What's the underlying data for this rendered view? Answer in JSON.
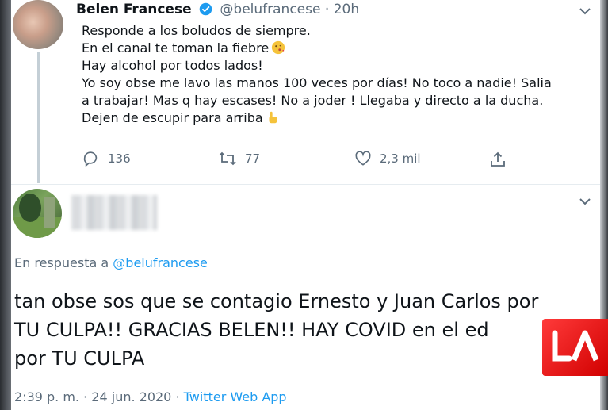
{
  "tweet1": {
    "name": "Belen Francese",
    "handle": "@belufrancese",
    "separator": "·",
    "time": "20h",
    "lines": [
      "Responde a los boludos de siempre.",
      "En el canal te toman la fiebre",
      "Hay alcohol por todos lados!",
      "Yo soy obse me lavo las manos 100 veces por días! No toco  a nadie! Salia",
      "a trabajar! Mas q hay escases! No a joder ! Llegaba y directo a la ducha.",
      "Dejen de escupir para arriba"
    ],
    "emoji_line2": "kiss-emoji",
    "emoji_line6": "pointing-up-emoji",
    "replies": "136",
    "retweets": "77",
    "likes": "2,3 mil"
  },
  "tweet2": {
    "reply_prefix": "En respuesta a",
    "reply_handle": "@belufrancese",
    "lines": [
      "tan obse sos que se contagio Ernesto y Juan Carlos por",
      "TU CULPA!! GRACIAS BELEN!! HAY COVID en el ed",
      "por TU CULPA"
    ],
    "time": "2:39 p. m.",
    "date": "24 jun. 2020",
    "separator": "·",
    "app": "Twitter Web App"
  },
  "colors": {
    "link": "#1d9bf0",
    "muted": "#5b6b7a",
    "verified": "#1d9bf0",
    "logo": "#e00000"
  }
}
